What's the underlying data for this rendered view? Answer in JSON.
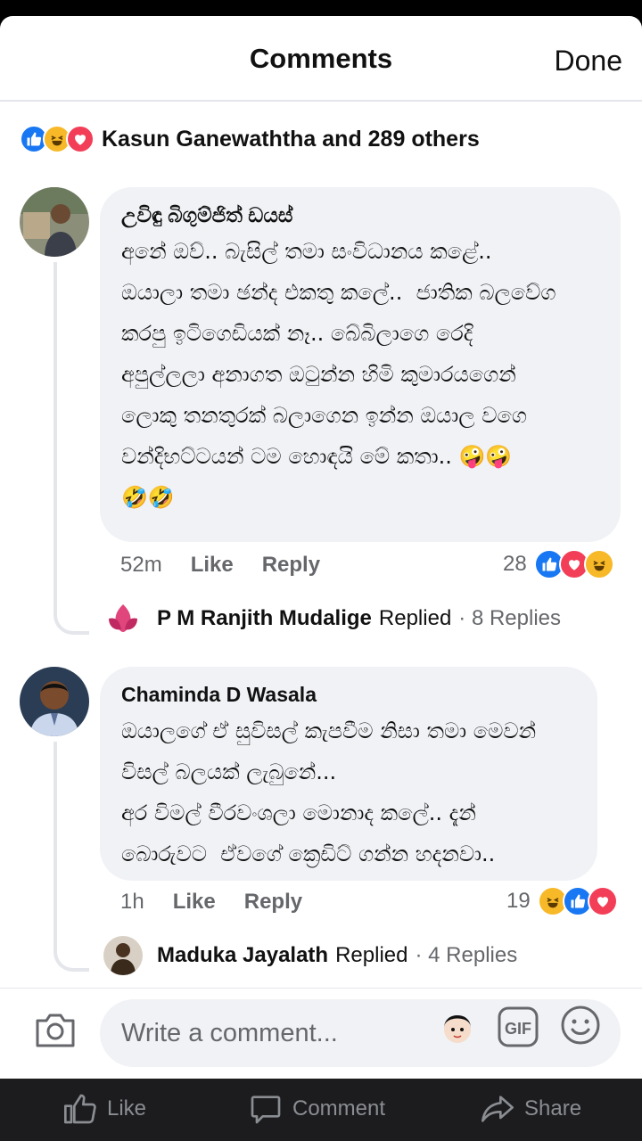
{
  "header": {
    "title": "Comments",
    "done_label": "Done"
  },
  "reactions_summary": {
    "text": "Kasun Ganewaththa and 289 others"
  },
  "comments": [
    {
      "author": "උවිඳු බිගුම්ජිත් ඩයස්",
      "text": "අනේ ඔව්.. බැසිල් තමා සංවිධානය කළේ..\nඔයාලා තමා ඡන්ද එකතු කලේ..  ජාතික බලවේග\nකරපු ඉටිගෙඩියක් නෑ.. බේබිලාගෙ රෙදි\nඅපුල්ලලා අනාගත ඔටුන්න හිමි කුමාරයගෙන්\nලොකු තනතුරක් බලාගෙන ඉන්න ඔයාල වගෙ\nවන්දිභට්ටයන් ටම හොඳයි මේ කතා.. 🤪🤪\n🤣🤣",
      "time": "52m",
      "like_label": "Like",
      "reply_label": "Reply",
      "reaction_count": "28",
      "replies": {
        "name": "P M Ranjith Mudalige",
        "replied": "Replied",
        "count": "· 8 Replies"
      }
    },
    {
      "author": "Chaminda D Wasala",
      "text": "ඔයාලගේ ඒ සුවිසල් කැපවීම නිසා තමා මෙවන්\nවිසල් බලයක් ලැබුනේ...\nඅර විමල් වීරවංශලා මොනාද කලේ.. දැන්\nබොරුවට  ඒවගේ ක්‍රෙඩිට් ගන්න හදනවා..",
      "time": "1h",
      "like_label": "Like",
      "reply_label": "Reply",
      "reaction_count": "19",
      "replies": {
        "name": "Maduka Jayalath",
        "replied": "Replied",
        "count": "· 4 Replies"
      }
    }
  ],
  "composer": {
    "placeholder": "Write a comment...",
    "gif_label": "GIF"
  },
  "tabbar": {
    "like": "Like",
    "comment": "Comment",
    "share": "Share"
  },
  "colors": {
    "like_blue": "#1877f2",
    "haha_yellow": "#f7b928",
    "love_red": "#f33e58",
    "bubble_gray": "#f0f2f5"
  }
}
